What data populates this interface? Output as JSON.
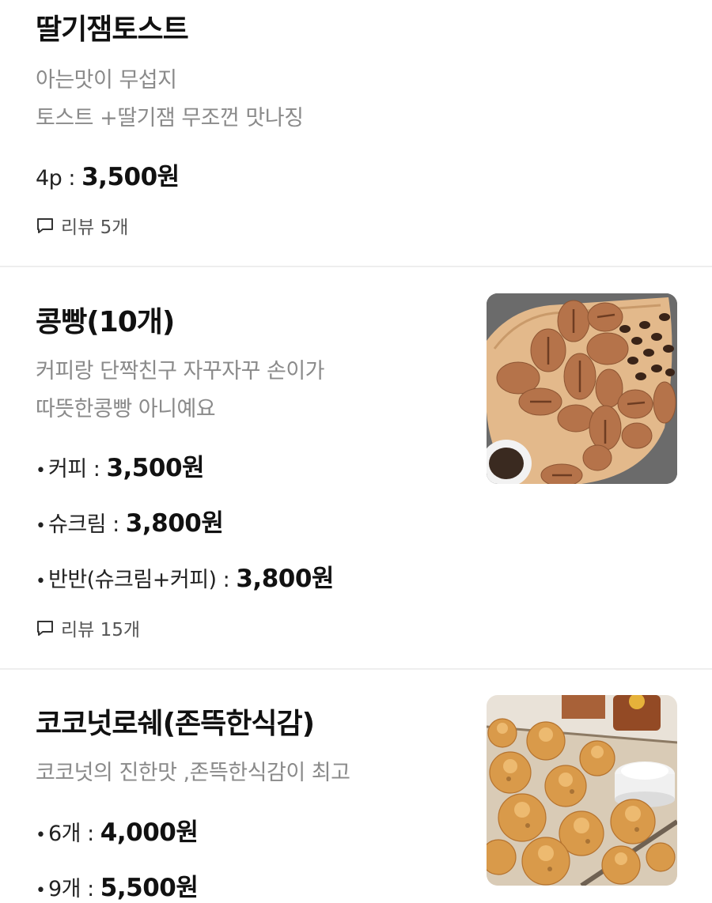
{
  "items": [
    {
      "name": "딸기잼토스트",
      "desc": [
        "아는맛이 무섭지",
        "토스트 +딸기잼 무조껀 맛나징"
      ],
      "prices": [
        {
          "label": "4p : ",
          "amount": "3,500원"
        }
      ],
      "review": "리뷰 5개"
    },
    {
      "name": "콩빵(10개)",
      "desc": [
        "커피랑 단짝친구 자꾸자꾸 손이가",
        "따뜻한콩빵 아니예요"
      ],
      "prices": [
        {
          "bullet": "•",
          "label": "커피 : ",
          "amount": "3,500원"
        },
        {
          "bullet": "•",
          "label": "슈크림 : ",
          "amount": "3,800원"
        },
        {
          "bullet": "•",
          "label": "반반(슈크림+커피) : ",
          "amount": "3,800원"
        }
      ],
      "review": "리뷰 15개"
    },
    {
      "name": "코코넛로쉐(존뜩한식감)",
      "desc": [
        "코코넛의 진한맛 ,존뜩한식감이 최고"
      ],
      "prices": [
        {
          "bullet": "•",
          "label": "6개 : ",
          "amount": "4,000원"
        },
        {
          "bullet": "•",
          "label": "9개 : ",
          "amount": "5,500원"
        }
      ]
    }
  ],
  "colors": {
    "desc": "#8a8a8a",
    "divider": "#eeeeee",
    "title": "#111111"
  },
  "icons": {
    "review": "speech-bubble-icon"
  }
}
